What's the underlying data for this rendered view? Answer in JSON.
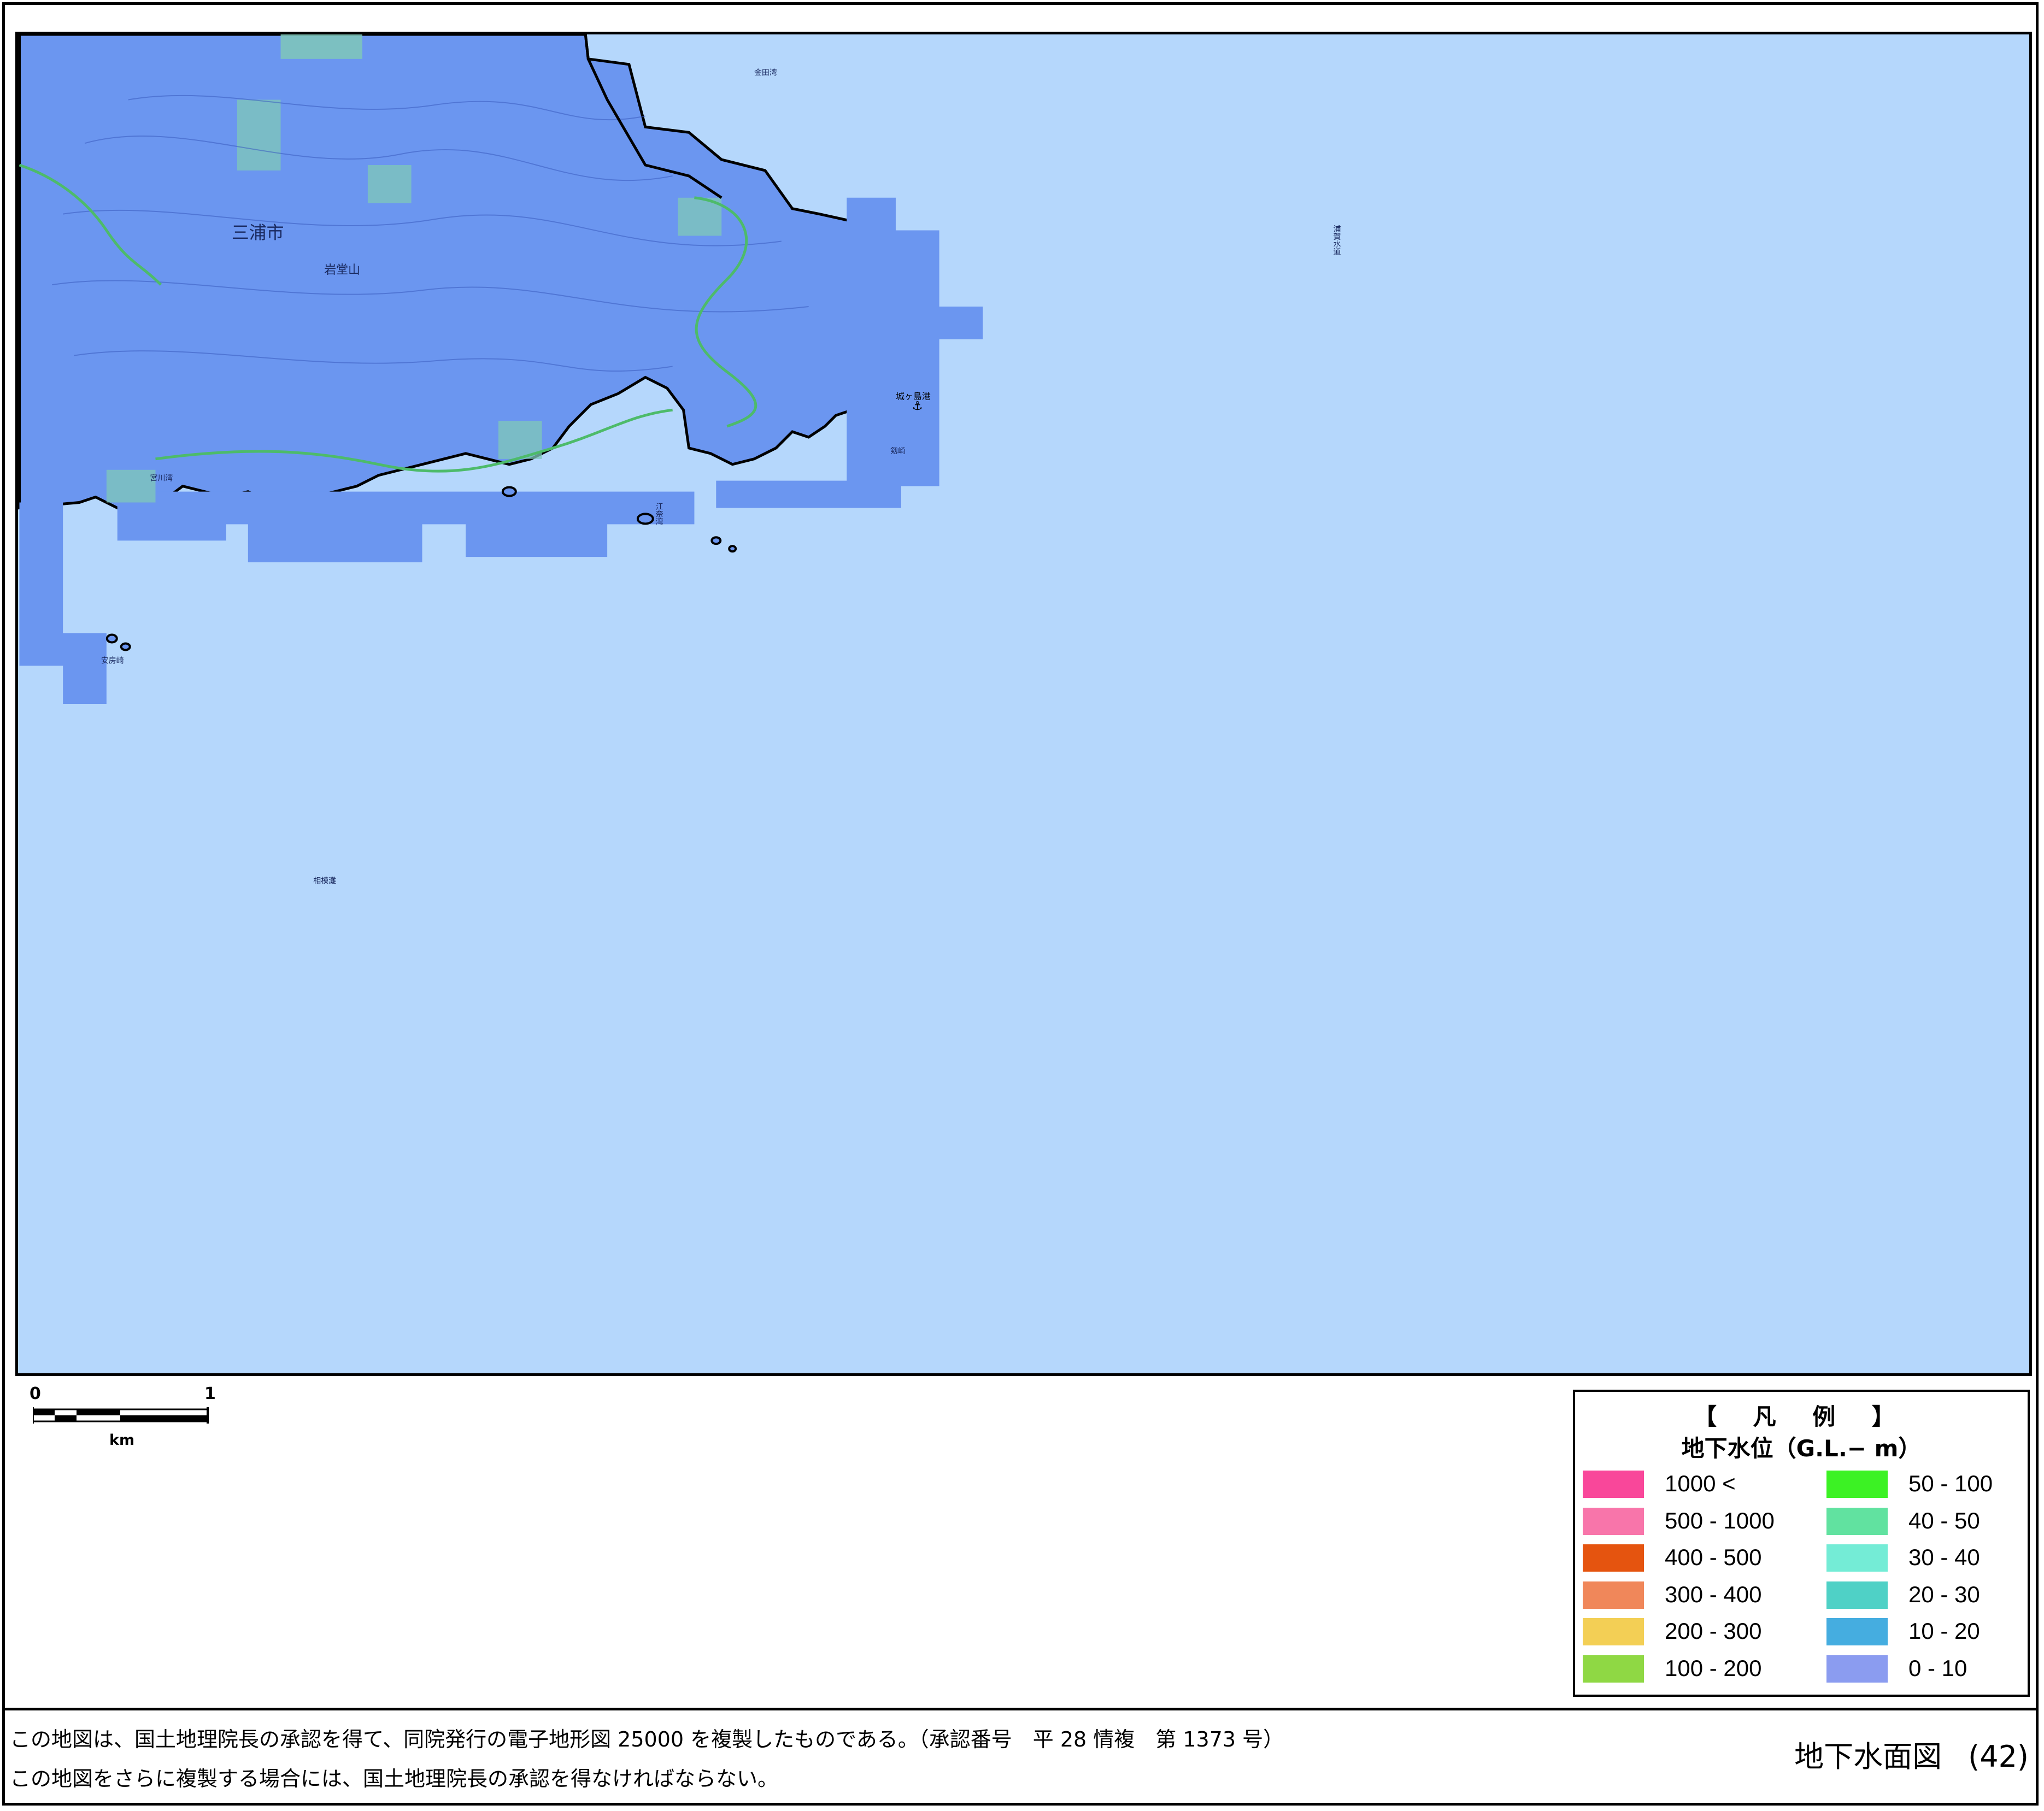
{
  "map": {
    "labels": {
      "city": "三浦市",
      "mountain": "岩堂山",
      "bay_north": "金田湾",
      "channel": "浦賀水道",
      "sea_south": "相模灘",
      "port": "城ヶ島港",
      "cape": "剱崎",
      "bay_west": "宮川湾",
      "bay_south": "江奈湾",
      "point_west": "安房崎"
    },
    "colors": {
      "sea": "#b5d7fc",
      "land_class_0_10": "#6b96f0",
      "land_class_10_20_greenish": "#7fc8b8",
      "coastline": "#000000",
      "river_line": "#4dbb6a"
    }
  },
  "scalebar": {
    "start": "0",
    "end": "1",
    "unit": "km"
  },
  "legend": {
    "title": "【 凡 例 】",
    "subtitle": "地下水位（G.L.− m）",
    "items": [
      {
        "label": "1000 <",
        "color": "#f9479a"
      },
      {
        "label": "500 - 1000",
        "color": "#f875aa"
      },
      {
        "label": "400 - 500",
        "color": "#e5540f"
      },
      {
        "label": "300 - 400",
        "color": "#f0875a"
      },
      {
        "label": "200 - 300",
        "color": "#f3cf55"
      },
      {
        "label": "100 - 200",
        "color": "#8fd844"
      },
      {
        "label": "50 - 100",
        "color": "#3cf224"
      },
      {
        "label": "40 - 50",
        "color": "#61e2a0"
      },
      {
        "label": "30 - 40",
        "color": "#74ecd6"
      },
      {
        "label": "20 - 30",
        "color": "#4fd1c6"
      },
      {
        "label": "10 - 20",
        "color": "#45ade0"
      },
      {
        "label": "0 - 10",
        "color": "#8b9cf0"
      }
    ]
  },
  "footer": {
    "note1": "この地図は、国土地理院長の承認を得て、同院発行の電子地形図 25000 を複製したものである。（承認番号　平 28 情複　第 1373 号）",
    "note2": "この地図をさらに複製する場合には、国土地理院長の承認を得なければならない。",
    "sheet_title": "地下水面図",
    "sheet_number": "(42)"
  }
}
